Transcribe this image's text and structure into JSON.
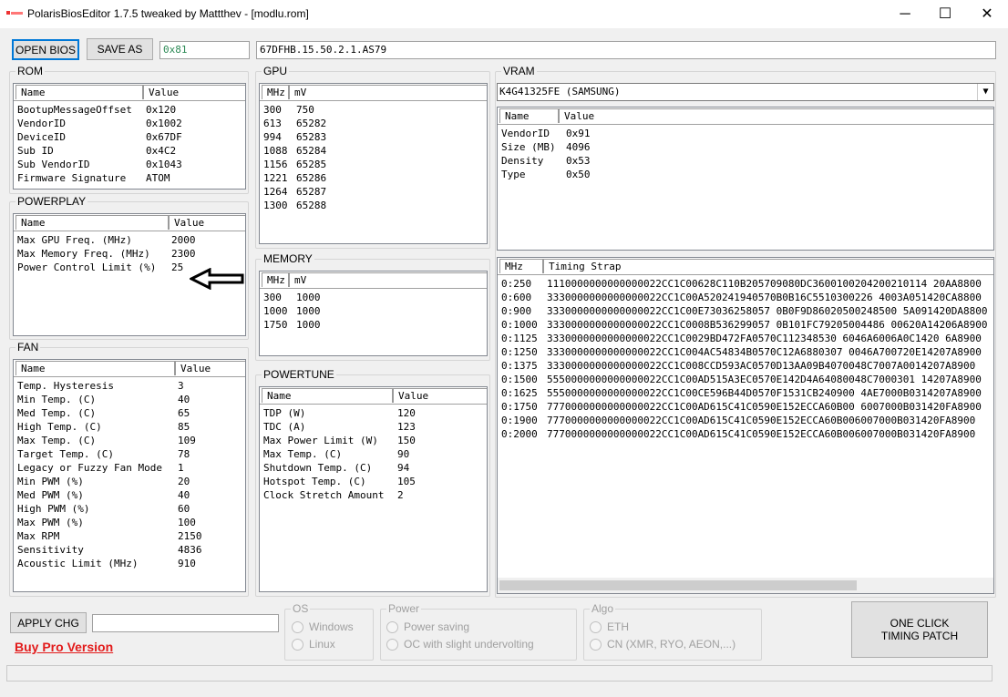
{
  "window": {
    "title": "PolarisBiosEditor 1.7.5 tweaked by Mattthev  - [modlu.rom]",
    "minimize_glyph": "─",
    "maximize_glyph": "☐",
    "close_glyph": "✕"
  },
  "toolbar": {
    "open_bios_label": "OPEN BIOS",
    "save_as_label": "SAVE AS",
    "checksum_value": "0x81",
    "bios_name_value": "67DFHB.15.50.2.1.AS79"
  },
  "rom": {
    "label": "ROM",
    "headers": [
      "Name",
      "Value"
    ],
    "rows": [
      {
        "name": "BootupMessageOffset",
        "value": "0x120"
      },
      {
        "name": "VendorID",
        "value": "0x1002"
      },
      {
        "name": "DeviceID",
        "value": "0x67DF"
      },
      {
        "name": "Sub ID",
        "value": "0x4C2"
      },
      {
        "name": "Sub VendorID",
        "value": "0x1043"
      },
      {
        "name": "Firmware Signature",
        "value": "ATOM"
      }
    ]
  },
  "powerplay": {
    "label": "POWERPLAY",
    "headers": [
      "Name",
      "Value"
    ],
    "rows": [
      {
        "name": "Max GPU Freq. (MHz)",
        "value": "2000"
      },
      {
        "name": "Max Memory Freq. (MHz)",
        "value": "2300"
      },
      {
        "name": "Power Control Limit (%)",
        "value": "25"
      }
    ]
  },
  "fan": {
    "label": "FAN",
    "headers": [
      "Name",
      "Value"
    ],
    "rows": [
      {
        "name": "Temp. Hysteresis",
        "value": "3"
      },
      {
        "name": "Min Temp. (C)",
        "value": "40"
      },
      {
        "name": "Med Temp. (C)",
        "value": "65"
      },
      {
        "name": "High Temp. (C)",
        "value": "85"
      },
      {
        "name": "Max Temp. (C)",
        "value": "109"
      },
      {
        "name": "Target Temp. (C)",
        "value": "78"
      },
      {
        "name": "Legacy or Fuzzy Fan Mode",
        "value": "1"
      },
      {
        "name": "Min PWM (%)",
        "value": "20"
      },
      {
        "name": "Med PWM (%)",
        "value": "40"
      },
      {
        "name": "High PWM (%)",
        "value": "60"
      },
      {
        "name": "Max PWM (%)",
        "value": "100"
      },
      {
        "name": "Max RPM",
        "value": "2150"
      },
      {
        "name": "Sensitivity",
        "value": "4836"
      },
      {
        "name": "Acoustic Limit (MHz)",
        "value": "910"
      }
    ]
  },
  "gpu": {
    "label": "GPU",
    "headers": [
      "MHz",
      "mV"
    ],
    "rows": [
      {
        "mhz": "300",
        "mv": "750"
      },
      {
        "mhz": "613",
        "mv": "65282"
      },
      {
        "mhz": "994",
        "mv": "65283"
      },
      {
        "mhz": "1088",
        "mv": "65284"
      },
      {
        "mhz": "1156",
        "mv": "65285"
      },
      {
        "mhz": "1221",
        "mv": "65286"
      },
      {
        "mhz": "1264",
        "mv": "65287"
      },
      {
        "mhz": "1300",
        "mv": "65288"
      }
    ]
  },
  "memory": {
    "label": "MEMORY",
    "headers": [
      "MHz",
      "mV"
    ],
    "rows": [
      {
        "mhz": "300",
        "mv": "1000"
      },
      {
        "mhz": "1000",
        "mv": "1000"
      },
      {
        "mhz": "1750",
        "mv": "1000"
      }
    ]
  },
  "powertune": {
    "label": "POWERTUNE",
    "headers": [
      "Name",
      "Value"
    ],
    "rows": [
      {
        "name": "TDP (W)",
        "value": "120"
      },
      {
        "name": "TDC (A)",
        "value": "123"
      },
      {
        "name": "Max Power Limit (W)",
        "value": "150"
      },
      {
        "name": "Max Temp. (C)",
        "value": "90"
      },
      {
        "name": "Shutdown Temp. (C)",
        "value": "94"
      },
      {
        "name": "Hotspot Temp. (C)",
        "value": "105"
      },
      {
        "name": "Clock Stretch Amount",
        "value": "2"
      }
    ]
  },
  "vram": {
    "label": "VRAM",
    "selected_memory": "K4G41325FE (SAMSUNG)",
    "dropdown_glyph": "▼",
    "headers": [
      "Name",
      "Value"
    ],
    "rows": [
      {
        "name": "VendorID",
        "value": "0x91"
      },
      {
        "name": "Size (MB)",
        "value": "4096"
      },
      {
        "name": "Density",
        "value": "0x53"
      },
      {
        "name": "Type",
        "value": "0x50"
      }
    ],
    "timing_headers": [
      "MHz",
      "Timing Strap"
    ],
    "timing_rows": [
      {
        "mhz": "0:250",
        "strap": "1110000000000000022CC1C00628C110B205709080DC3600100204200210114 20AA8800"
      },
      {
        "mhz": "0:600",
        "strap": "3330000000000000022CC1C00A520241940570B0B16C5510300226 4003A051420CA8800"
      },
      {
        "mhz": "0:900",
        "strap": "3330000000000000022CC1C00E73036258057 0B0F9D86020500248500 5A091420DA8800"
      },
      {
        "mhz": "0:1000",
        "strap": "3330000000000000022CC1C0008B536299057 0B101FC79205004486 00620A14206A8900"
      },
      {
        "mhz": "0:1125",
        "strap": "3330000000000000022CC1C0029BD472FA0570C112348530 6046A6006A0C1420 6A8900"
      },
      {
        "mhz": "0:1250",
        "strap": "3330000000000000022CC1C004AC54834B0570C12A6880307 0046A700720E14207A8900"
      },
      {
        "mhz": "0:1375",
        "strap": "3330000000000000022CC1C008CCD593AC0570D13AA09B4070048C7007A0014207A8900"
      },
      {
        "mhz": "0:1500",
        "strap": "5550000000000000022CC1C00AD515A3EC0570E142D4A64080048C7000301 14207A8900"
      },
      {
        "mhz": "0:1625",
        "strap": "5550000000000000022CC1C00CE596B44D0570F1531CB240900 4AE7000B0314207A8900"
      },
      {
        "mhz": "0:1750",
        "strap": "7770000000000000022CC1C00AD615C41C0590E152ECCA60B00 6007000B031420FA8900"
      },
      {
        "mhz": "0:1900",
        "strap": "7770000000000000022CC1C00AD615C41C0590E152ECCA60B006007000B031420FA8900"
      },
      {
        "mhz": "0:2000",
        "strap": "7770000000000000022CC1C00AD615C41C0590E152ECCA60B006007000B031420FA8900"
      }
    ]
  },
  "bottom": {
    "apply_label": "APPLY CHG",
    "apply_input_value": "",
    "buy_pro_label": "Buy Pro Version",
    "os_label": "OS",
    "os_options": [
      "Windows",
      "Linux"
    ],
    "power_label": "Power",
    "power_options": [
      "Power saving",
      "OC with slight undervolting"
    ],
    "algo_label": "Algo",
    "algo_options": [
      "ETH",
      "CN (XMR, RYO, AEON,...)"
    ],
    "one_click_label": "ONE CLICK TIMING PATCH",
    "status_value": ""
  },
  "colors": {
    "checksum_text": "#2e8b57",
    "buy_pro": "#e21b1b",
    "focus_border": "#0078d7"
  }
}
